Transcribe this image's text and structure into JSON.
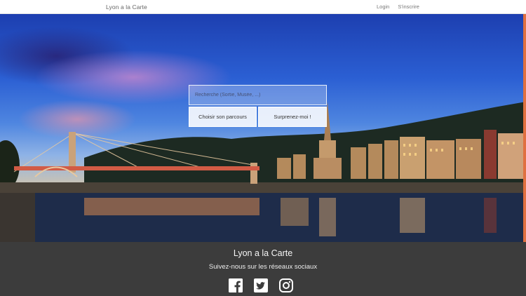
{
  "navbar": {
    "brand": "Lyon a la Carte",
    "links": [
      "Login",
      "S'inscrire"
    ]
  },
  "search": {
    "placeholder": "Recherche (Sortie, Musée, ...)",
    "left_button": "Choisir son parcours",
    "right_button": "Surprenez-moi !"
  },
  "footer": {
    "title": "Lyon a la Carte",
    "subtitle": "Suivez-nous sur les réseaux sociaux",
    "socials": [
      "facebook-icon",
      "twitter-icon",
      "instagram-icon"
    ]
  },
  "colors": {
    "footer_bg": "#3c3c3c",
    "accent": "#e07040"
  }
}
